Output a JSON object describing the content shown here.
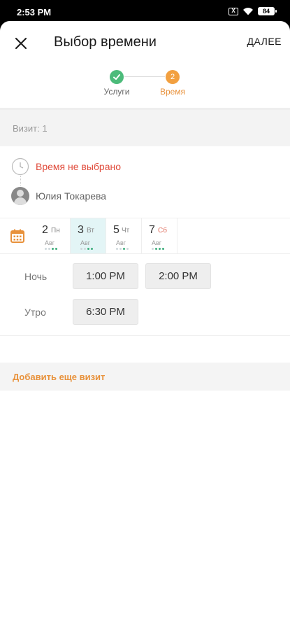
{
  "status_bar": {
    "time": "2:53 PM",
    "battery": "84",
    "notification_icon": "x-notification-icon",
    "wifi_icon": "wifi-icon"
  },
  "header": {
    "title": "Выбор времени",
    "next_label": "ДАЛЕЕ"
  },
  "stepper": {
    "steps": [
      {
        "label": "Услуги",
        "state": "done",
        "icon": "check-icon"
      },
      {
        "label": "Время",
        "state": "current",
        "number": "2"
      }
    ]
  },
  "visit": {
    "header": "Визит: 1",
    "time_status": "Время не выбрано",
    "staff_name": "Юлия Токарева"
  },
  "dates": [
    {
      "day": "2",
      "weekday": "Пн",
      "month": "Авг",
      "selected": false,
      "weekend": false,
      "dots": [
        false,
        false,
        true,
        true
      ]
    },
    {
      "day": "3",
      "weekday": "Вт",
      "month": "Авг",
      "selected": true,
      "weekend": false,
      "dots": [
        false,
        false,
        true,
        true
      ]
    },
    {
      "day": "5",
      "weekday": "Чт",
      "month": "Авг",
      "selected": false,
      "weekend": false,
      "dots": [
        false,
        false,
        true,
        false
      ]
    },
    {
      "day": "7",
      "weekday": "Сб",
      "month": "Авг",
      "selected": false,
      "weekend": true,
      "dots": [
        false,
        true,
        true,
        true
      ]
    }
  ],
  "slots": [
    {
      "period": "Ночь",
      "times": [
        "1:00 PM",
        "2:00 PM"
      ]
    },
    {
      "period": "Утро",
      "times": [
        "6:30 PM"
      ]
    }
  ],
  "add_visit_label": "Добавить еще визит",
  "colors": {
    "accent": "#e8913a",
    "success": "#4cbb7a",
    "warning": "#e04b3b",
    "selected_date_bg": "#e3f5f6"
  }
}
